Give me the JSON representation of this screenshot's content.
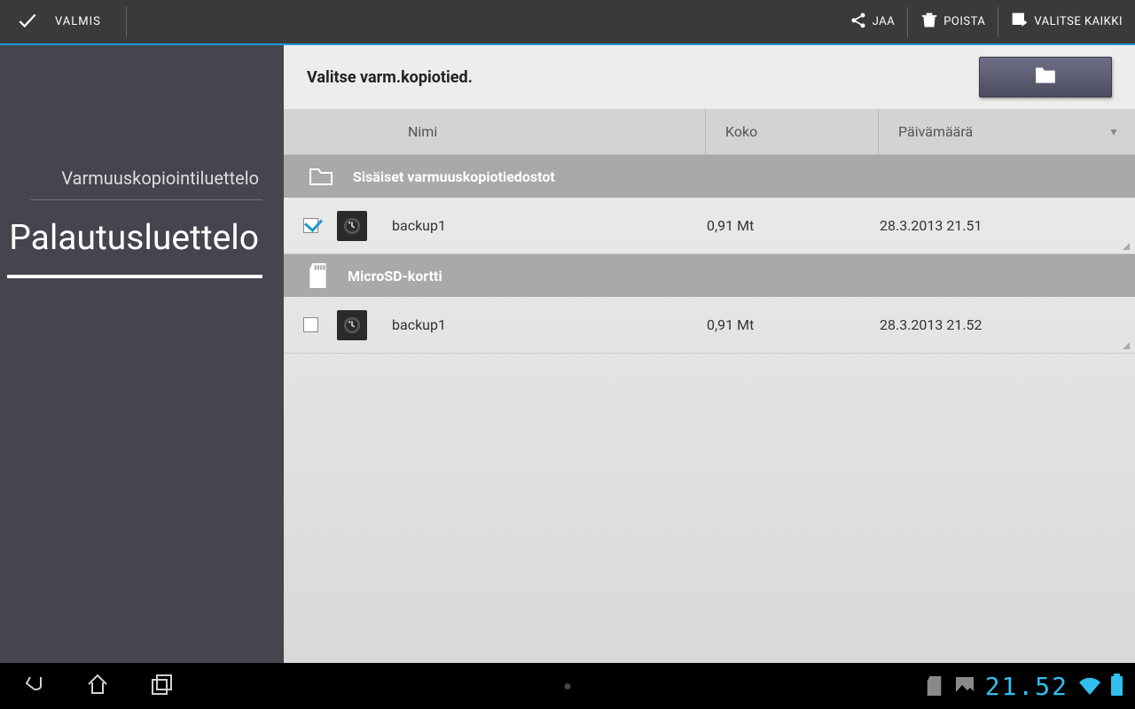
{
  "topbar": {
    "done_label": "VALMIS",
    "share_label": "JAA",
    "delete_label": "POISTA",
    "select_all_label": "VALITSE KAIKKI"
  },
  "sidebar": {
    "backup_list": "Varmuuskopiointiluettelo",
    "restore_list": "Palautusluettelo"
  },
  "main": {
    "title": "Valitse varm.kopiotied.",
    "columns": {
      "name": "Nimi",
      "size": "Koko",
      "date": "Päivämäärä"
    },
    "sections": [
      {
        "label": "Sisäiset varmuuskopiotiedostot",
        "icon": "folder",
        "files": [
          {
            "checked": true,
            "name": "backup1",
            "size": "0,91 Mt",
            "date": "28.3.2013 21.51"
          }
        ]
      },
      {
        "label": "MicroSD-kortti",
        "icon": "sd",
        "files": [
          {
            "checked": false,
            "name": "backup1",
            "size": "0,91 Mt",
            "date": "28.3.2013 21.52"
          }
        ]
      }
    ]
  },
  "statusbar": {
    "time": "21.52"
  }
}
